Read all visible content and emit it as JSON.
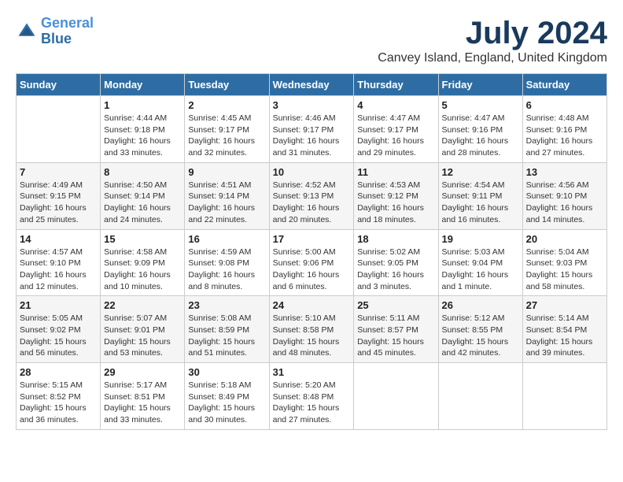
{
  "header": {
    "logo_line1": "General",
    "logo_line2": "Blue",
    "month_title": "July 2024",
    "location": "Canvey Island, England, United Kingdom"
  },
  "weekdays": [
    "Sunday",
    "Monday",
    "Tuesday",
    "Wednesday",
    "Thursday",
    "Friday",
    "Saturday"
  ],
  "weeks": [
    [
      {
        "day": "",
        "sunrise": "",
        "sunset": "",
        "daylight": ""
      },
      {
        "day": "1",
        "sunrise": "Sunrise: 4:44 AM",
        "sunset": "Sunset: 9:18 PM",
        "daylight": "Daylight: 16 hours and 33 minutes."
      },
      {
        "day": "2",
        "sunrise": "Sunrise: 4:45 AM",
        "sunset": "Sunset: 9:17 PM",
        "daylight": "Daylight: 16 hours and 32 minutes."
      },
      {
        "day": "3",
        "sunrise": "Sunrise: 4:46 AM",
        "sunset": "Sunset: 9:17 PM",
        "daylight": "Daylight: 16 hours and 31 minutes."
      },
      {
        "day": "4",
        "sunrise": "Sunrise: 4:47 AM",
        "sunset": "Sunset: 9:17 PM",
        "daylight": "Daylight: 16 hours and 29 minutes."
      },
      {
        "day": "5",
        "sunrise": "Sunrise: 4:47 AM",
        "sunset": "Sunset: 9:16 PM",
        "daylight": "Daylight: 16 hours and 28 minutes."
      },
      {
        "day": "6",
        "sunrise": "Sunrise: 4:48 AM",
        "sunset": "Sunset: 9:16 PM",
        "daylight": "Daylight: 16 hours and 27 minutes."
      }
    ],
    [
      {
        "day": "7",
        "sunrise": "Sunrise: 4:49 AM",
        "sunset": "Sunset: 9:15 PM",
        "daylight": "Daylight: 16 hours and 25 minutes."
      },
      {
        "day": "8",
        "sunrise": "Sunrise: 4:50 AM",
        "sunset": "Sunset: 9:14 PM",
        "daylight": "Daylight: 16 hours and 24 minutes."
      },
      {
        "day": "9",
        "sunrise": "Sunrise: 4:51 AM",
        "sunset": "Sunset: 9:14 PM",
        "daylight": "Daylight: 16 hours and 22 minutes."
      },
      {
        "day": "10",
        "sunrise": "Sunrise: 4:52 AM",
        "sunset": "Sunset: 9:13 PM",
        "daylight": "Daylight: 16 hours and 20 minutes."
      },
      {
        "day": "11",
        "sunrise": "Sunrise: 4:53 AM",
        "sunset": "Sunset: 9:12 PM",
        "daylight": "Daylight: 16 hours and 18 minutes."
      },
      {
        "day": "12",
        "sunrise": "Sunrise: 4:54 AM",
        "sunset": "Sunset: 9:11 PM",
        "daylight": "Daylight: 16 hours and 16 minutes."
      },
      {
        "day": "13",
        "sunrise": "Sunrise: 4:56 AM",
        "sunset": "Sunset: 9:10 PM",
        "daylight": "Daylight: 16 hours and 14 minutes."
      }
    ],
    [
      {
        "day": "14",
        "sunrise": "Sunrise: 4:57 AM",
        "sunset": "Sunset: 9:10 PM",
        "daylight": "Daylight: 16 hours and 12 minutes."
      },
      {
        "day": "15",
        "sunrise": "Sunrise: 4:58 AM",
        "sunset": "Sunset: 9:09 PM",
        "daylight": "Daylight: 16 hours and 10 minutes."
      },
      {
        "day": "16",
        "sunrise": "Sunrise: 4:59 AM",
        "sunset": "Sunset: 9:08 PM",
        "daylight": "Daylight: 16 hours and 8 minutes."
      },
      {
        "day": "17",
        "sunrise": "Sunrise: 5:00 AM",
        "sunset": "Sunset: 9:06 PM",
        "daylight": "Daylight: 16 hours and 6 minutes."
      },
      {
        "day": "18",
        "sunrise": "Sunrise: 5:02 AM",
        "sunset": "Sunset: 9:05 PM",
        "daylight": "Daylight: 16 hours and 3 minutes."
      },
      {
        "day": "19",
        "sunrise": "Sunrise: 5:03 AM",
        "sunset": "Sunset: 9:04 PM",
        "daylight": "Daylight: 16 hours and 1 minute."
      },
      {
        "day": "20",
        "sunrise": "Sunrise: 5:04 AM",
        "sunset": "Sunset: 9:03 PM",
        "daylight": "Daylight: 15 hours and 58 minutes."
      }
    ],
    [
      {
        "day": "21",
        "sunrise": "Sunrise: 5:05 AM",
        "sunset": "Sunset: 9:02 PM",
        "daylight": "Daylight: 15 hours and 56 minutes."
      },
      {
        "day": "22",
        "sunrise": "Sunrise: 5:07 AM",
        "sunset": "Sunset: 9:01 PM",
        "daylight": "Daylight: 15 hours and 53 minutes."
      },
      {
        "day": "23",
        "sunrise": "Sunrise: 5:08 AM",
        "sunset": "Sunset: 8:59 PM",
        "daylight": "Daylight: 15 hours and 51 minutes."
      },
      {
        "day": "24",
        "sunrise": "Sunrise: 5:10 AM",
        "sunset": "Sunset: 8:58 PM",
        "daylight": "Daylight: 15 hours and 48 minutes."
      },
      {
        "day": "25",
        "sunrise": "Sunrise: 5:11 AM",
        "sunset": "Sunset: 8:57 PM",
        "daylight": "Daylight: 15 hours and 45 minutes."
      },
      {
        "day": "26",
        "sunrise": "Sunrise: 5:12 AM",
        "sunset": "Sunset: 8:55 PM",
        "daylight": "Daylight: 15 hours and 42 minutes."
      },
      {
        "day": "27",
        "sunrise": "Sunrise: 5:14 AM",
        "sunset": "Sunset: 8:54 PM",
        "daylight": "Daylight: 15 hours and 39 minutes."
      }
    ],
    [
      {
        "day": "28",
        "sunrise": "Sunrise: 5:15 AM",
        "sunset": "Sunset: 8:52 PM",
        "daylight": "Daylight: 15 hours and 36 minutes."
      },
      {
        "day": "29",
        "sunrise": "Sunrise: 5:17 AM",
        "sunset": "Sunset: 8:51 PM",
        "daylight": "Daylight: 15 hours and 33 minutes."
      },
      {
        "day": "30",
        "sunrise": "Sunrise: 5:18 AM",
        "sunset": "Sunset: 8:49 PM",
        "daylight": "Daylight: 15 hours and 30 minutes."
      },
      {
        "day": "31",
        "sunrise": "Sunrise: 5:20 AM",
        "sunset": "Sunset: 8:48 PM",
        "daylight": "Daylight: 15 hours and 27 minutes."
      },
      {
        "day": "",
        "sunrise": "",
        "sunset": "",
        "daylight": ""
      },
      {
        "day": "",
        "sunrise": "",
        "sunset": "",
        "daylight": ""
      },
      {
        "day": "",
        "sunrise": "",
        "sunset": "",
        "daylight": ""
      }
    ]
  ]
}
